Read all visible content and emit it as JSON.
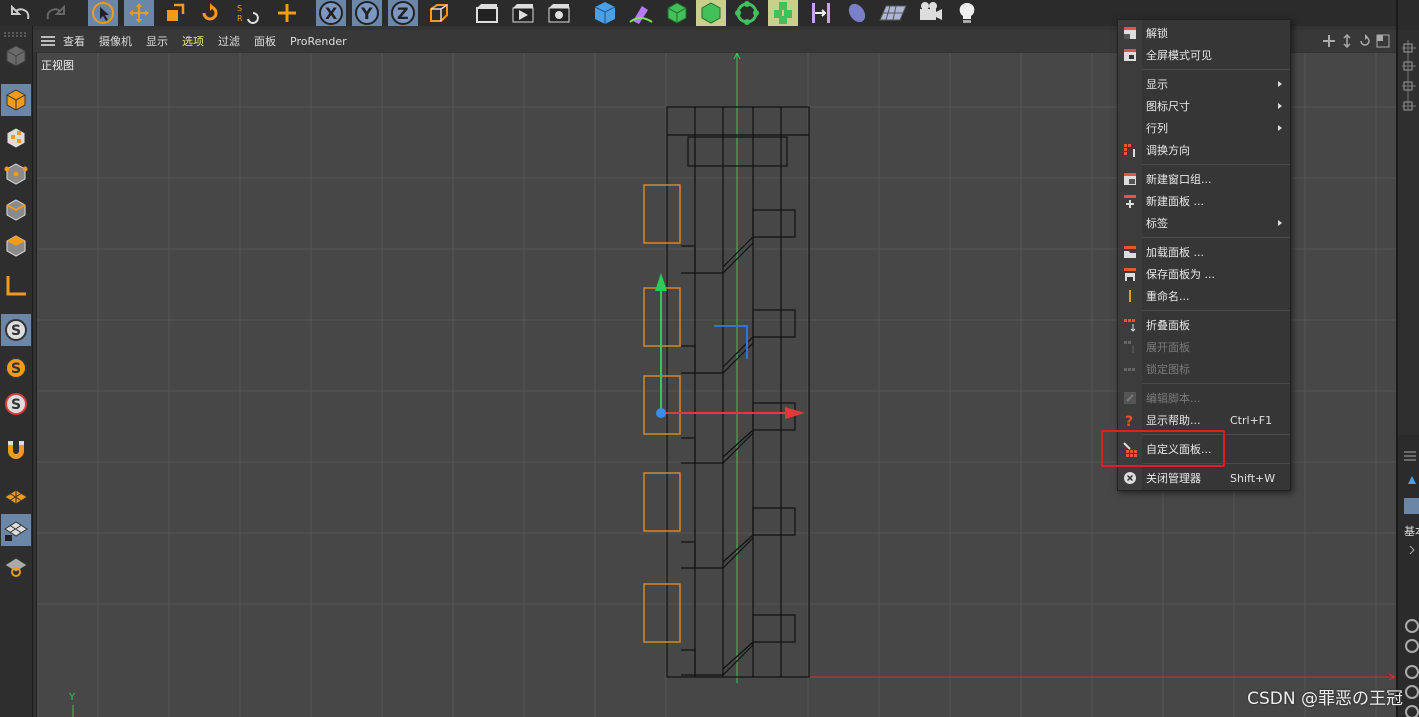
{
  "viewport": {
    "menu": [
      "查看",
      "摄像机",
      "显示",
      "选项",
      "过滤",
      "面板",
      "ProRender"
    ],
    "view_label": "正视图",
    "axis_y_label": "Y"
  },
  "context_menu": {
    "items": [
      {
        "label": "解锁",
        "enabled": true
      },
      {
        "label": "全屏模式可见",
        "enabled": true
      },
      {
        "label": "显示",
        "enabled": true,
        "submenu": true
      },
      {
        "label": "图标尺寸",
        "enabled": true,
        "submenu": true
      },
      {
        "label": "行列",
        "enabled": true,
        "submenu": true
      },
      {
        "label": "调换方向",
        "enabled": true
      },
      {
        "label": "新建窗口组...",
        "enabled": true
      },
      {
        "label": "新建面板 ...",
        "enabled": true
      },
      {
        "label": "标签",
        "enabled": true,
        "submenu": true
      },
      {
        "label": "加载面板 ...",
        "enabled": true
      },
      {
        "label": "保存面板为 ...",
        "enabled": true
      },
      {
        "label": "重命名...",
        "enabled": true
      },
      {
        "label": "折叠面板",
        "enabled": true
      },
      {
        "label": "展开面板",
        "enabled": false
      },
      {
        "label": "锁定图标",
        "enabled": false
      },
      {
        "label": "编辑脚本...",
        "enabled": false
      },
      {
        "label": "显示帮助...",
        "enabled": true,
        "shortcut": "Ctrl+F1"
      },
      {
        "label": "自定义面板...",
        "enabled": true,
        "highlighted": true
      },
      {
        "label": "关闭管理器",
        "enabled": true,
        "shortcut": "Shift+W"
      }
    ]
  },
  "right_panel": {
    "label": "基本"
  },
  "watermark": "CSDN @罪恶の王冠",
  "colors": {
    "highlight_box": "#e02020",
    "active_tool": "#6c86a8",
    "selection_orange": "#e08a2a",
    "axis_x": "#e03a3a",
    "axis_y": "#2ecc55",
    "menu_highlight": "#e6e690"
  }
}
